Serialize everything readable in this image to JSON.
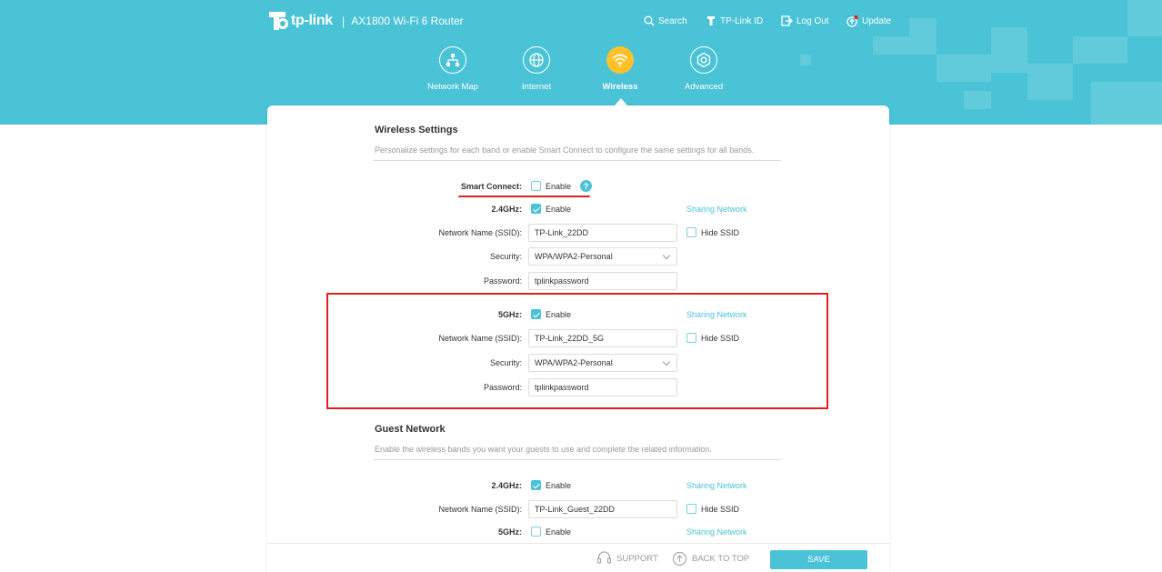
{
  "colors": {
    "brand": "#4ac3d6",
    "active_nav": "#ffc12b",
    "highlight": "#e02020"
  },
  "header": {
    "brand": "tp-link",
    "separator": "|",
    "model": "AX1800 Wi-Fi 6 Router",
    "top_links": [
      {
        "label": "Search",
        "icon": "search-icon"
      },
      {
        "label": "TP-Link ID",
        "icon": "tplink-id-icon"
      },
      {
        "label": "Log Out",
        "icon": "logout-icon"
      },
      {
        "label": "Update",
        "icon": "update-icon"
      }
    ],
    "nav": [
      {
        "label": "Network Map",
        "icon": "network-map-icon",
        "active": false
      },
      {
        "label": "Internet",
        "icon": "globe-icon",
        "active": false
      },
      {
        "label": "Wireless",
        "icon": "wifi-icon",
        "active": true
      },
      {
        "label": "Advanced",
        "icon": "gear-icon",
        "active": false
      }
    ]
  },
  "wireless": {
    "title": "Wireless Settings",
    "description": "Personalize settings for each band or enable Smart Connect to configure the same settings for all bands.",
    "smart_connect": {
      "label": "Smart Connect:",
      "option": "Enable",
      "checked": false,
      "help": "?"
    },
    "band_24": {
      "label": "2.4GHz:",
      "enable": "Enable",
      "checked": true,
      "sharing": "Sharing Network",
      "ssid_label": "Network Name (SSID):",
      "ssid": "TP-Link_22DD",
      "hide_ssid": "Hide SSID",
      "hide_checked": false,
      "security_label": "Security:",
      "security": "WPA/WPA2-Personal",
      "password_label": "Password:",
      "password": "tplinkpassword"
    },
    "band_5": {
      "label": "5GHz:",
      "enable": "Enable",
      "checked": true,
      "sharing": "Sharing Network",
      "ssid_label": "Network Name (SSID):",
      "ssid": "TP-Link_22DD_5G",
      "hide_ssid": "Hide SSID",
      "hide_checked": false,
      "security_label": "Security:",
      "security": "WPA/WPA2-Personal",
      "password_label": "Password:",
      "password": "tplinkpassword"
    }
  },
  "guest": {
    "title": "Guest Network",
    "description": "Enable the wireless bands you want your guests to use and complete the related information.",
    "band_24": {
      "label": "2.4GHz:",
      "enable": "Enable",
      "checked": true,
      "sharing": "Sharing Network",
      "ssid_label": "Network Name (SSID):",
      "ssid": "TP-Link_Guest_22DD",
      "hide_ssid": "Hide SSID",
      "hide_checked": false
    },
    "band_5": {
      "label": "5GHz:",
      "enable": "Enable",
      "checked": false,
      "sharing": "Sharing Network"
    }
  },
  "footer": {
    "support": "SUPPORT",
    "back_to_top": "BACK TO TOP",
    "save": "SAVE"
  }
}
